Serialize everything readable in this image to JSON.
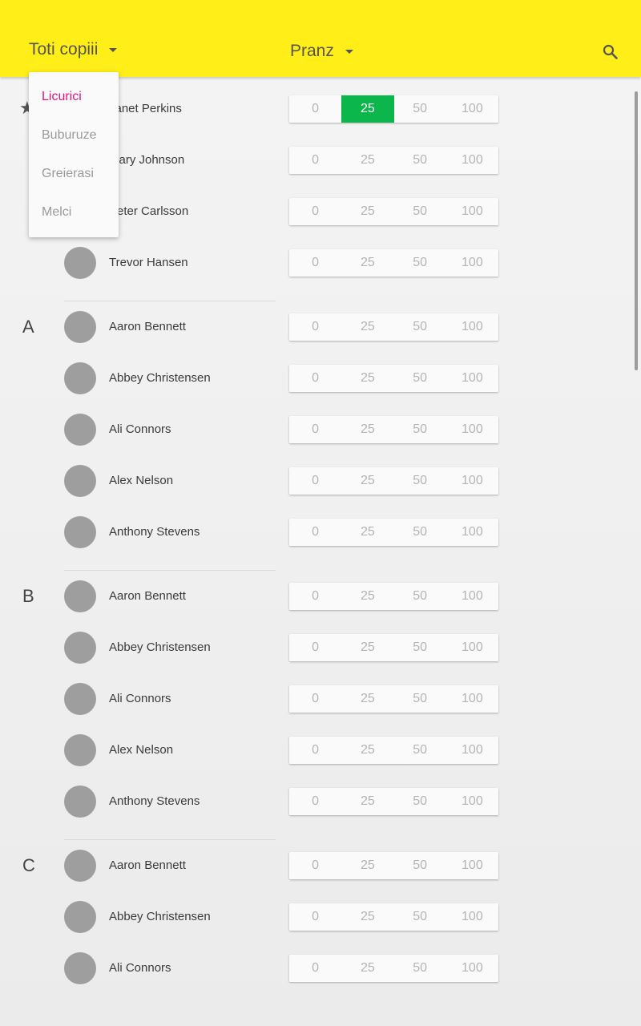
{
  "appbar": {
    "group_selector": "Toti copiii",
    "meal_selector": "Pranz",
    "search_icon": "search-icon"
  },
  "group_menu": {
    "items": [
      "Licurici",
      "Buburuze",
      "Greierasi",
      "Melci"
    ],
    "selected_index": 0,
    "selected_color": "#e5127d"
  },
  "options": [
    "0",
    "25",
    "50",
    "100"
  ],
  "colors": {
    "appbar": "#ffee18",
    "selected_option": "#0bb64b",
    "avatar": "#9e9e9e"
  },
  "favorites": [
    {
      "name": "Janet Perkins",
      "selected": "25"
    },
    {
      "name": "Mary Johnson",
      "selected": null
    },
    {
      "name": "Peter Carlsson",
      "selected": null
    },
    {
      "name": "Trevor Hansen",
      "selected": null
    }
  ],
  "sections": [
    {
      "letter": "A",
      "children": [
        "Aaron Bennett",
        "Abbey Christensen",
        "Ali Connors",
        "Alex Nelson",
        "Anthony Stevens"
      ]
    },
    {
      "letter": "B",
      "children": [
        "Aaron Bennett",
        "Abbey Christensen",
        "Ali Connors",
        "Alex Nelson",
        "Anthony Stevens"
      ]
    },
    {
      "letter": "C",
      "children": [
        "Aaron Bennett",
        "Abbey Christensen",
        "Ali Connors"
      ]
    }
  ]
}
